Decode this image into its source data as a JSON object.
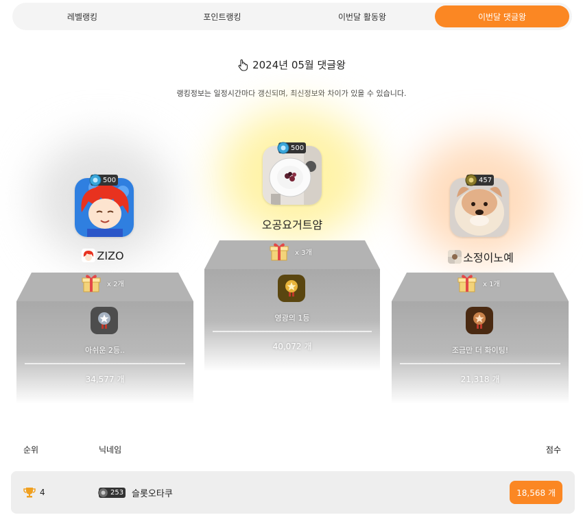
{
  "tabs": [
    {
      "label": "레벨랭킹",
      "active": false
    },
    {
      "label": "포인트랭킹",
      "active": false
    },
    {
      "label": "이번달 활동왕",
      "active": false
    },
    {
      "label": "이번달 댓글왕",
      "active": true
    }
  ],
  "header": {
    "title": "2024년 05월 댓글왕",
    "notice": "랭킹정보는 일정시간마다 갱신되며, 최신정보와 차이가 있을 수 있습니다."
  },
  "podium": {
    "first": {
      "level": "500",
      "nickname": "오공요거트얌",
      "gift": "x 3개",
      "medal_text": "영광의 1등",
      "score": "40,072 개"
    },
    "second": {
      "level": "500",
      "nickname": "ZIZO",
      "gift": "x 2개",
      "medal_text": "아쉬운 2등..",
      "score": "34,577 개"
    },
    "third": {
      "level": "457",
      "nickname": "소정이노예",
      "gift": "x 1개",
      "medal_text": "조금만 더 화이팅!",
      "score": "21,318 개"
    }
  },
  "table": {
    "headers": {
      "rank": "순위",
      "nickname": "닉네임",
      "score": "점수"
    },
    "rows": [
      {
        "rank": "4",
        "level": "253",
        "nickname": "슬롯오타쿠",
        "score": "18,568 개"
      }
    ]
  },
  "colors": {
    "accent": "#fb8723",
    "podium": "#a9a9a9",
    "gold_glow": "#fff2a0",
    "bronze_glow": "#ffd9b8"
  }
}
